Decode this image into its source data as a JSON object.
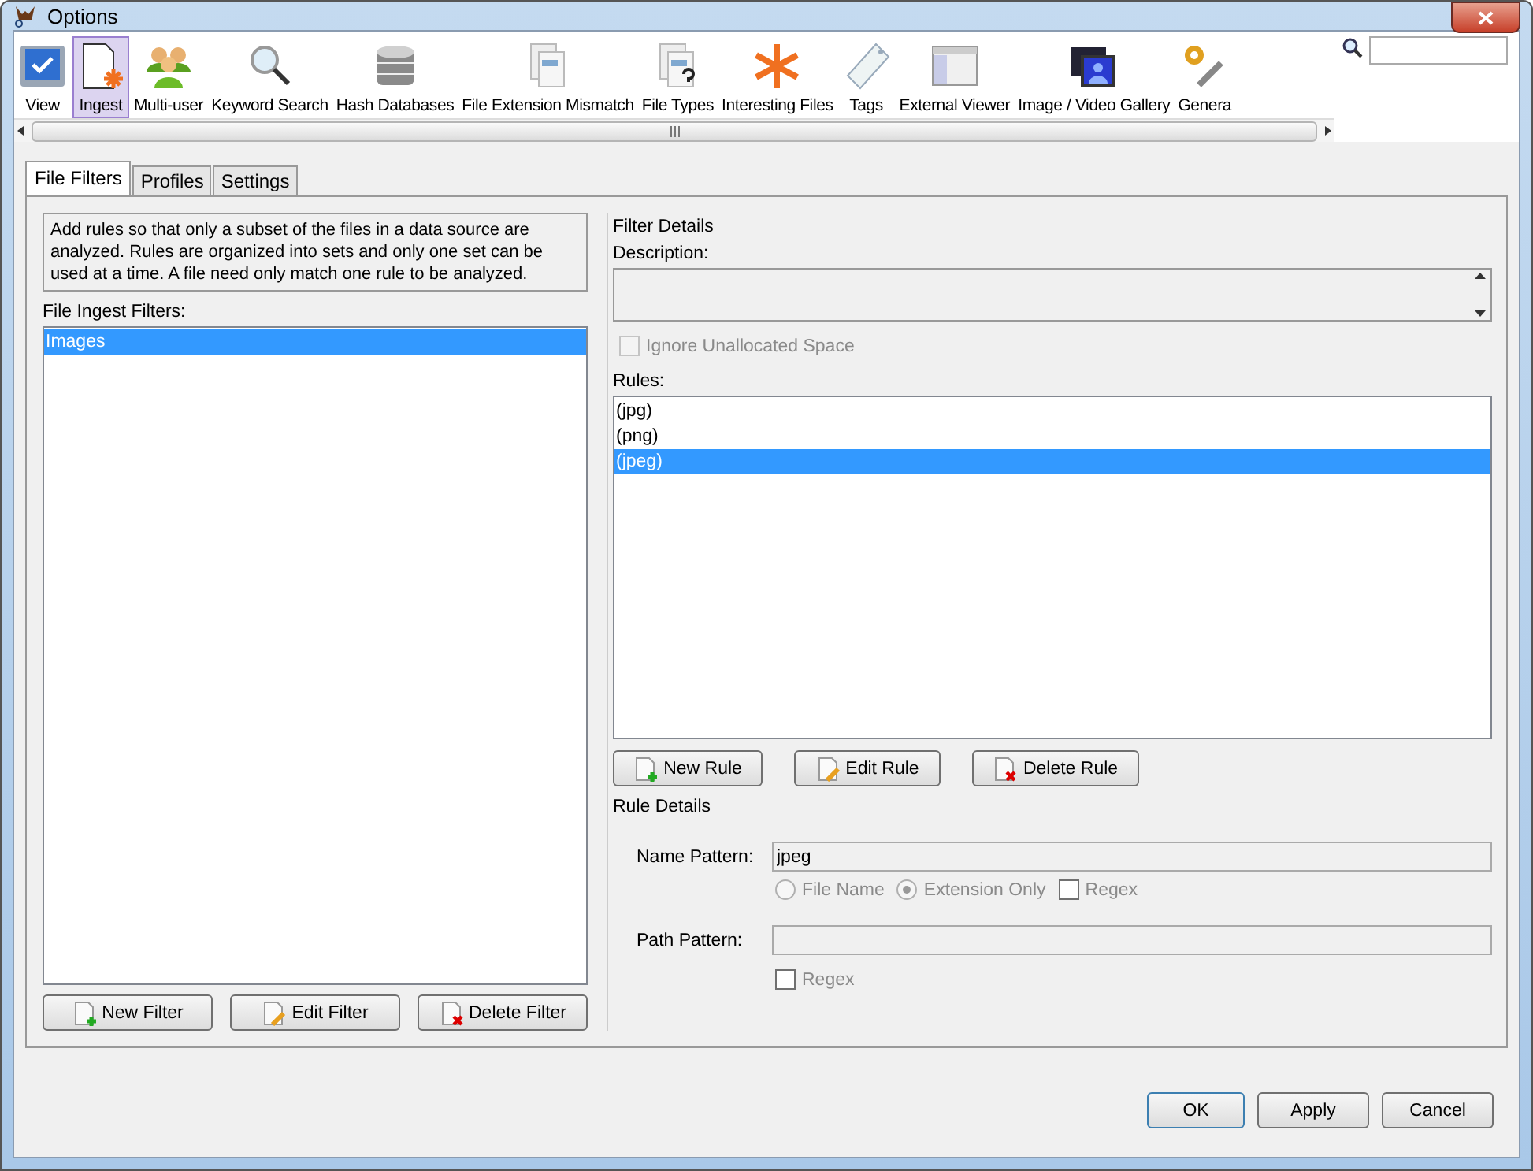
{
  "window": {
    "title": "Options"
  },
  "toolbar": [
    {
      "label": "View",
      "kind": "check",
      "selected": false
    },
    {
      "label": "Ingest",
      "kind": "ingest",
      "selected": true
    },
    {
      "label": "Multi-user",
      "kind": "users",
      "selected": false
    },
    {
      "label": "Keyword Search",
      "kind": "magnifier",
      "selected": false
    },
    {
      "label": "Hash Databases",
      "kind": "database",
      "selected": false
    },
    {
      "label": "File Extension Mismatch",
      "kind": "docs",
      "selected": false
    },
    {
      "label": "File Types",
      "kind": "docsq",
      "selected": false
    },
    {
      "label": "Interesting Files",
      "kind": "asterisk",
      "selected": false
    },
    {
      "label": "Tags",
      "kind": "tag",
      "selected": false
    },
    {
      "label": "External Viewer",
      "kind": "window",
      "selected": false
    },
    {
      "label": "Image / Video Gallery",
      "kind": "gallery",
      "selected": false
    },
    {
      "label": "Genera",
      "kind": "gear",
      "selected": false
    }
  ],
  "tabs": [
    {
      "label": "File Filters",
      "selected": true
    },
    {
      "label": "Profiles",
      "selected": false
    },
    {
      "label": "Settings",
      "selected": false
    }
  ],
  "info": "Add rules so that only a subset of the files in a data source are analyzed. Rules are organized into sets and only one set can be used at a time. A file need only match one rule to be analyzed.",
  "filters_label": "File Ingest Filters:",
  "filters": [
    {
      "label": "Images",
      "selected": true
    }
  ],
  "filter_buttons": [
    {
      "label": "New Filter",
      "kind": "new"
    },
    {
      "label": "Edit Filter",
      "kind": "edit"
    },
    {
      "label": "Delete Filter",
      "kind": "delete"
    }
  ],
  "filter_details": {
    "title": "Filter Details",
    "description_label": "Description:",
    "ignore_unallocated": {
      "label": "Ignore Unallocated Space",
      "checked": false,
      "disabled": true
    }
  },
  "rules_label": "Rules:",
  "rules": [
    {
      "label": "(jpg)",
      "selected": false
    },
    {
      "label": "(png)",
      "selected": false
    },
    {
      "label": "(jpeg)",
      "selected": true
    }
  ],
  "rule_buttons": [
    {
      "label": "New Rule",
      "kind": "new"
    },
    {
      "label": "Edit Rule",
      "kind": "edit"
    },
    {
      "label": "Delete Rule",
      "kind": "delete"
    }
  ],
  "rule_details": {
    "title": "Rule Details",
    "name_label": "Name Pattern:",
    "name_value": "jpeg",
    "name_options": [
      {
        "label": "File Name",
        "kind": "radio",
        "selected": false
      },
      {
        "label": "Extension Only",
        "kind": "radio",
        "selected": true
      },
      {
        "label": "Regex",
        "kind": "checkbox",
        "checked": false
      }
    ],
    "path_label": "Path Pattern:",
    "path_regex": {
      "label": "Regex",
      "checked": false
    }
  },
  "buttons": [
    "OK",
    "Apply",
    "Cancel"
  ]
}
